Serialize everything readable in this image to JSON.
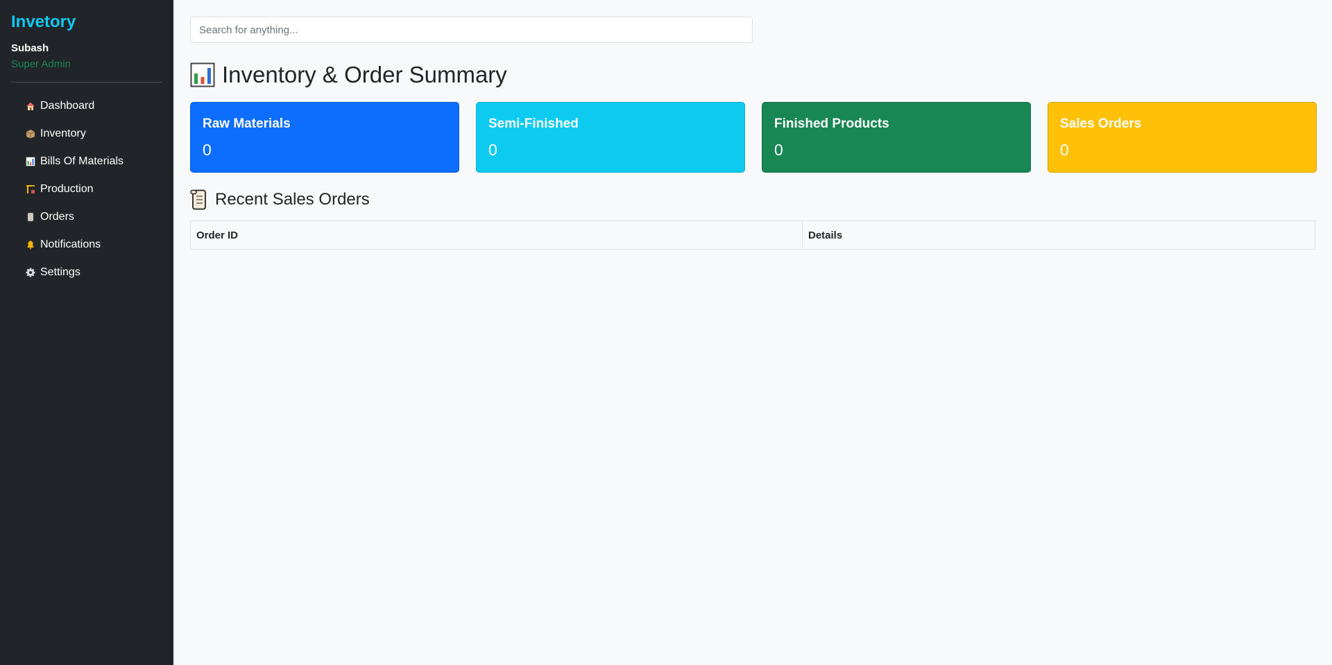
{
  "sidebar": {
    "brand": "Invetory",
    "user": {
      "name": "Subash",
      "role": "Super Admin"
    },
    "items": [
      {
        "label": "Dashboard",
        "icon": "house-icon"
      },
      {
        "label": "Inventory",
        "icon": "box-icon"
      },
      {
        "label": "Bills Of Materials",
        "icon": "bar-chart-icon"
      },
      {
        "label": "Production",
        "icon": "construction-icon"
      },
      {
        "label": "Orders",
        "icon": "scroll-icon"
      },
      {
        "label": "Notifications",
        "icon": "bell-icon"
      },
      {
        "label": "Settings",
        "icon": "gear-icon"
      }
    ]
  },
  "search": {
    "placeholder": "Search for anything..."
  },
  "page_title": "Inventory & Order Summary",
  "cards": [
    {
      "title": "Raw Materials",
      "value": "0",
      "color": "#0d6efd"
    },
    {
      "title": "Semi-Finished",
      "value": "0",
      "color": "#0dcaf0"
    },
    {
      "title": "Finished Products",
      "value": "0",
      "color": "#198754"
    },
    {
      "title": "Sales Orders",
      "value": "0",
      "color": "#ffc107"
    }
  ],
  "recent_orders": {
    "title": "Recent Sales Orders",
    "columns": [
      "Order ID",
      "Details"
    ],
    "rows": []
  }
}
